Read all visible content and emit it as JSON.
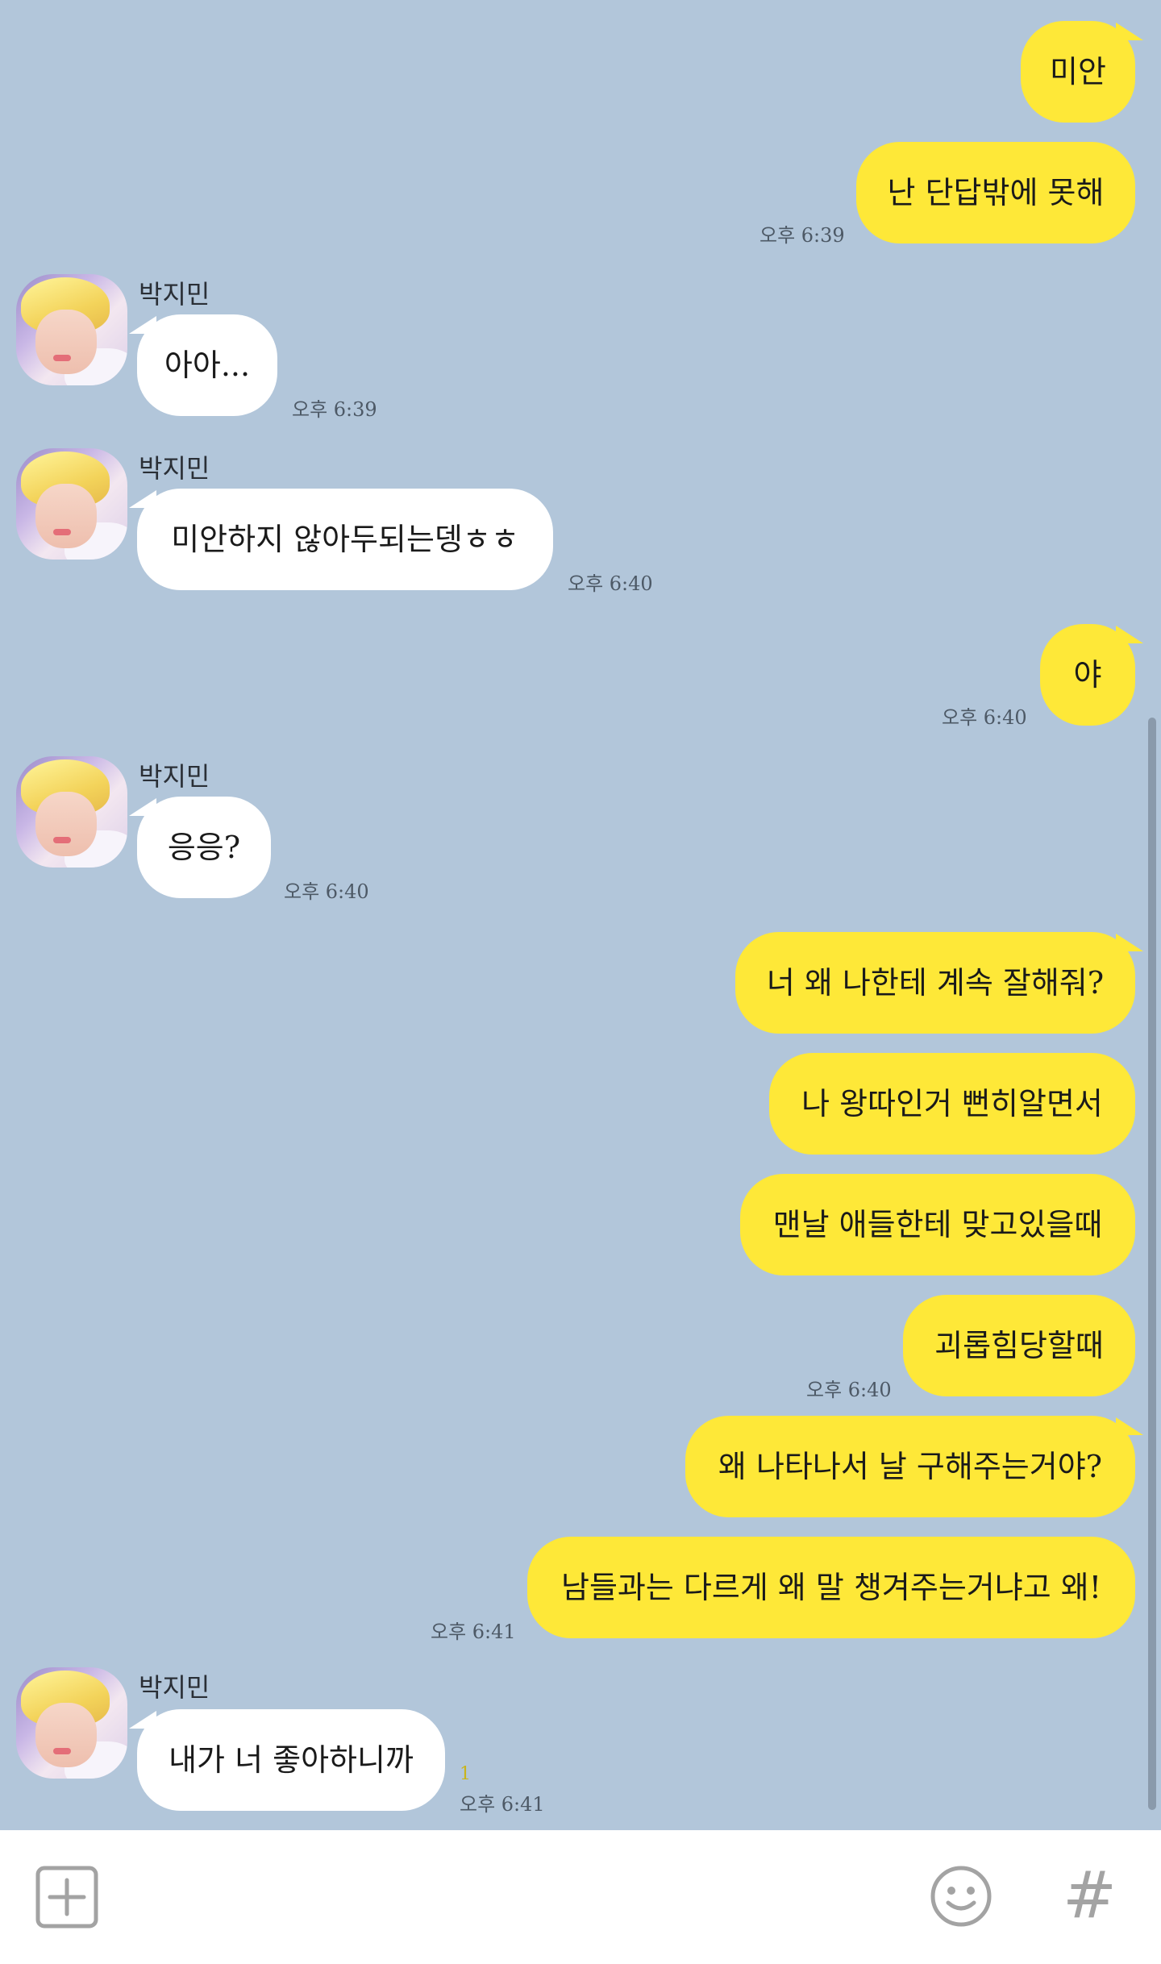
{
  "chat": {
    "sender_name": "박지민",
    "messages": [
      {
        "text": "미안"
      },
      {
        "text": "난 단답밖에 못해",
        "time": "오후 6:39"
      },
      {
        "text": "아아...",
        "time": "오후 6:39"
      },
      {
        "text": "미안하지 않아두되는뎅ㅎㅎ",
        "time": "오후 6:40"
      },
      {
        "text": "야",
        "time": "오후 6:40"
      },
      {
        "text": "응응?",
        "time": "오후 6:40"
      },
      {
        "text": "너 왜 나한테 계속 잘해줘?"
      },
      {
        "text": "나 왕따인거 뻔히알면서"
      },
      {
        "text": "맨날 애들한테 맞고있을때"
      },
      {
        "text": "괴롭힘당할때",
        "time": "오후 6:40"
      },
      {
        "text": "왜 나타나서 날 구해주는거야?"
      },
      {
        "text": "남들과는 다르게 왜 말 챙겨주는거냐고 왜!",
        "time": "오후 6:41"
      },
      {
        "text": "내가 너 좋아하니까",
        "time": "오후 6:41",
        "unread": "1"
      }
    ]
  },
  "footer": {
    "add_icon": "plus-square-icon",
    "emoji_icon": "smiley-icon",
    "hashtag_icon": "#"
  },
  "colors": {
    "background": "#b2c6da",
    "my_bubble": "#fee838",
    "their_bubble": "#ffffff"
  }
}
